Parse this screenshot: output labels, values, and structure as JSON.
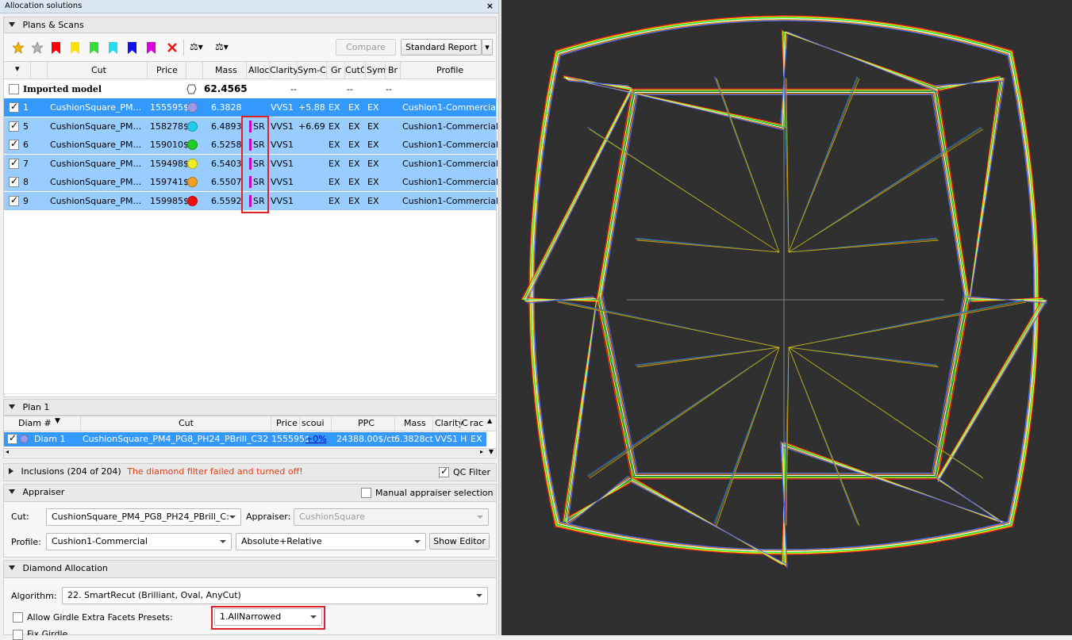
{
  "window": {
    "title": "Allocation solutions",
    "close": "×"
  },
  "plans_scans": {
    "header": "Plans & Scans",
    "toolbar": {
      "compare_label": "Compare",
      "report_label": "Standard Report",
      "scale1_label": "⚖▾",
      "scale2_label": "⚖▾",
      "colors": {
        "gold": "#f0b400",
        "red": "#ff0000",
        "yellow": "#ffe000",
        "green": "#33dd33",
        "cyan": "#22ddee",
        "blue": "#1010ee",
        "magenta": "#dd00dd",
        "x": "#ee1111"
      }
    },
    "columns": [
      "Cut",
      "Price",
      "Mass",
      "Alloc",
      "Clarity",
      "Sym-C",
      "Gr",
      "CutG",
      "Sym",
      "Br",
      "Profile"
    ],
    "imported": {
      "label": "Imported model",
      "mass": "62.4565",
      "dash1": "--",
      "dash2": "--",
      "dash3": "--"
    },
    "rows": [
      {
        "id": "1",
        "cut": "CushionSquare_PM...",
        "price": "155595$",
        "color": "#9a9ae8",
        "mass": "6.3828",
        "alloc": "",
        "clarity": "VVS1",
        "symc": "+5.88",
        "cutg": "EX",
        "sym": "EX",
        "br": "EX",
        "profile": "Cushion1-Commercial"
      },
      {
        "id": "5",
        "cut": "CushionSquare_PM...",
        "price": "158278$",
        "color": "#22ccee",
        "mass": "6.4893",
        "alloc": "SR",
        "clarity": "VVS1",
        "symc": "+6.69",
        "cutg": "EX",
        "sym": "EX",
        "br": "EX",
        "profile": "Cushion1-Commercial"
      },
      {
        "id": "6",
        "cut": "CushionSquare_PM...",
        "price": "159010$",
        "color": "#22cc22",
        "mass": "6.5258",
        "alloc": "SR",
        "clarity": "VVS1",
        "symc": "",
        "cutg": "EX",
        "sym": "EX",
        "br": "EX",
        "profile": "Cushion1-Commercial"
      },
      {
        "id": "7",
        "cut": "CushionSquare_PM...",
        "price": "159498$",
        "color": "#eeee22",
        "mass": "6.5403",
        "alloc": "SR",
        "clarity": "VVS1",
        "symc": "",
        "cutg": "EX",
        "sym": "EX",
        "br": "EX",
        "profile": "Cushion1-Commercial"
      },
      {
        "id": "8",
        "cut": "CushionSquare_PM...",
        "price": "159741$",
        "color": "#f0a020",
        "mass": "6.5507",
        "alloc": "SR",
        "clarity": "VVS1",
        "symc": "",
        "cutg": "EX",
        "sym": "EX",
        "br": "EX",
        "profile": "Cushion1-Commercial"
      },
      {
        "id": "9",
        "cut": "CushionSquare_PM...",
        "price": "159985$",
        "color": "#ee1111",
        "mass": "6.5592",
        "alloc": "SR",
        "clarity": "VVS1",
        "symc": "",
        "cutg": "EX",
        "sym": "EX",
        "br": "EX",
        "profile": "Cushion1-Commercial"
      }
    ]
  },
  "plan1": {
    "header": "Plan 1",
    "columns": {
      "diam": "Diam #",
      "cut": "Cut",
      "price": "Price",
      "discount": "scoui",
      "ppc": "PPC",
      "mass": "Mass",
      "clarity": "Clarity",
      "color": "C",
      "grade": "rac"
    },
    "row": {
      "diam": "Diam 1",
      "cut": "CushionSquare_PM4_PG8_PH24_PBrill_C32",
      "price": "155595$",
      "discount": "+0%",
      "ppc": "24388.00$/ct",
      "mass": "6.3828ct",
      "clarity": "VVS1",
      "color": "H",
      "grade": "EX"
    }
  },
  "inclusions": {
    "label": "Inclusions (204 of 204)",
    "warning": "The diamond filter failed and turned off!",
    "qc_filter": "QC Filter"
  },
  "appraiser": {
    "header": "Appraiser",
    "manual_label": "Manual appraiser selection",
    "cut_label": "Cut:",
    "cut_value": "CushionSquare_PM4_PG8_PH24_PBrill_C:",
    "appraiser_label": "Appraiser:",
    "appraiser_value": "CushionSquare",
    "profile_label": "Profile:",
    "profile_value": "Cushion1-Commercial",
    "mode_value": "Absolute+Relative",
    "show_editor": "Show Editor"
  },
  "allocation": {
    "header": "Diamond Allocation",
    "algorithm_label": "Algorithm:",
    "algorithm_value": "22. SmartRecut (Brilliant, Oval, AnyCut)",
    "girdle_label": "Allow Girdle Extra Facets",
    "presets_label": "Presets:",
    "presets_value": "1.AllNarrowed",
    "fix_label": "Fix Girdle"
  }
}
